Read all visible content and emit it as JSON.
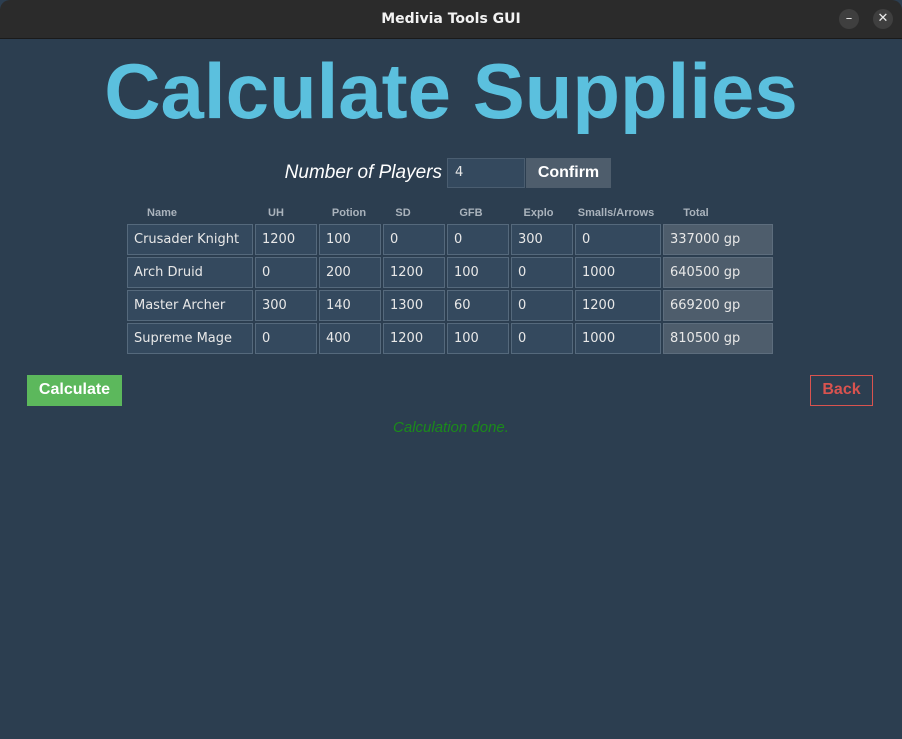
{
  "window": {
    "title": "Medivia Tools GUI",
    "minimize_glyph": "–",
    "close_glyph": "✕"
  },
  "heading": "Calculate Supplies",
  "players": {
    "label": "Number of Players",
    "value": "4",
    "confirm_label": "Confirm"
  },
  "table": {
    "headers": [
      "Name",
      "UH",
      "Potion",
      "SD",
      "GFB",
      "Explo",
      "Smalls/Arrows",
      "Total"
    ],
    "rows": [
      [
        "Crusader Knight",
        "1200",
        "100",
        "0",
        "0",
        "300",
        "0",
        "337000 gp"
      ],
      [
        "Arch Druid",
        "0",
        "200",
        "1200",
        "100",
        "0",
        "1000",
        "640500 gp"
      ],
      [
        "Master Archer",
        "300",
        "140",
        "1300",
        "60",
        "0",
        "1200",
        "669200 gp"
      ],
      [
        "Supreme Mage",
        "0",
        "400",
        "1200",
        "100",
        "0",
        "1000",
        "810500 gp"
      ]
    ]
  },
  "actions": {
    "calculate_label": "Calculate",
    "back_label": "Back"
  },
  "status": "Calculation done.",
  "colors": {
    "background": "#2c3e50",
    "heading": "#5bc0de",
    "calculate": "#5cb85c",
    "back": "#d9534f",
    "status": "#1b8a1b"
  }
}
